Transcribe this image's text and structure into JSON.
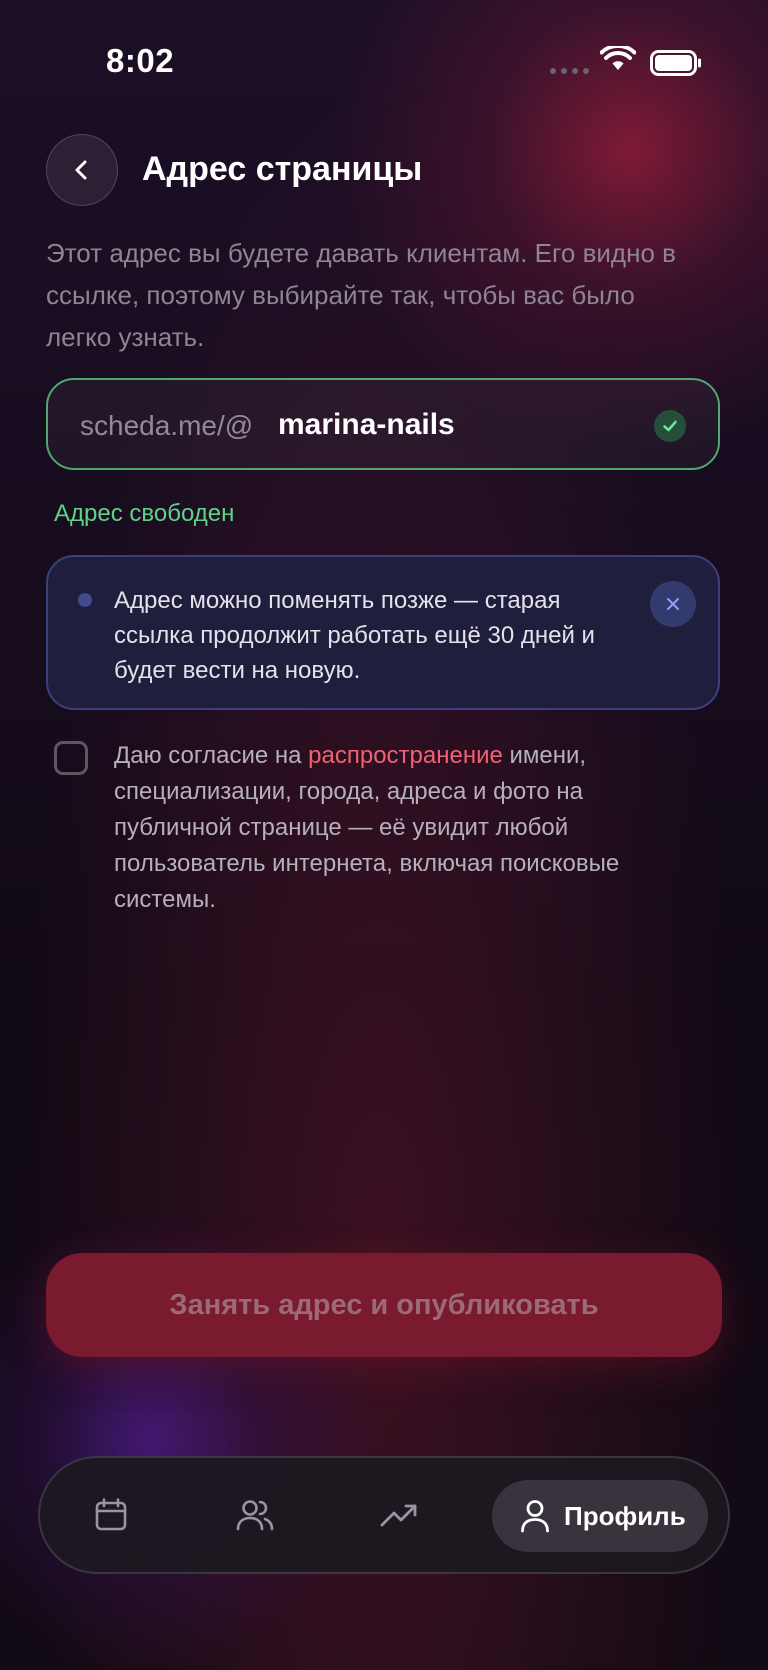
{
  "status_bar": {
    "time": "8:02"
  },
  "header": {
    "title": "Адрес страницы"
  },
  "description": "Этот адрес вы будете давать клиентам. Его видно в ссылке, поэтому выбирайте так, чтобы вас было легко узнать.",
  "url_field": {
    "prefix": "scheda.me/@",
    "value": "marina-nails"
  },
  "status_text": "Адрес свободен",
  "info_card": {
    "text": "Адрес можно поменять позже — старая ссылка продолжит работать ещё 30 дней и будет вести на новую."
  },
  "consent": {
    "before": "Даю согласие на ",
    "link": "распространение",
    "after": " имени, специализации, города, адреса и фото на публичной странице — её увидит любой пользователь интернета, включая поисковые системы.",
    "checked": false
  },
  "publish_button": {
    "label": "Занять адрес и опубликовать"
  },
  "bottom_nav": {
    "items": [
      {
        "icon": "calendar-icon"
      },
      {
        "icon": "clients-icon"
      },
      {
        "icon": "trending-icon"
      },
      {
        "icon": "profile-icon",
        "label": "Профиль",
        "active": true
      }
    ]
  },
  "colors": {
    "accent_green": "#5fd28a",
    "accent_red": "#f06272",
    "button_bg": "#791a2e",
    "info_bg": "#1f1f3d"
  }
}
